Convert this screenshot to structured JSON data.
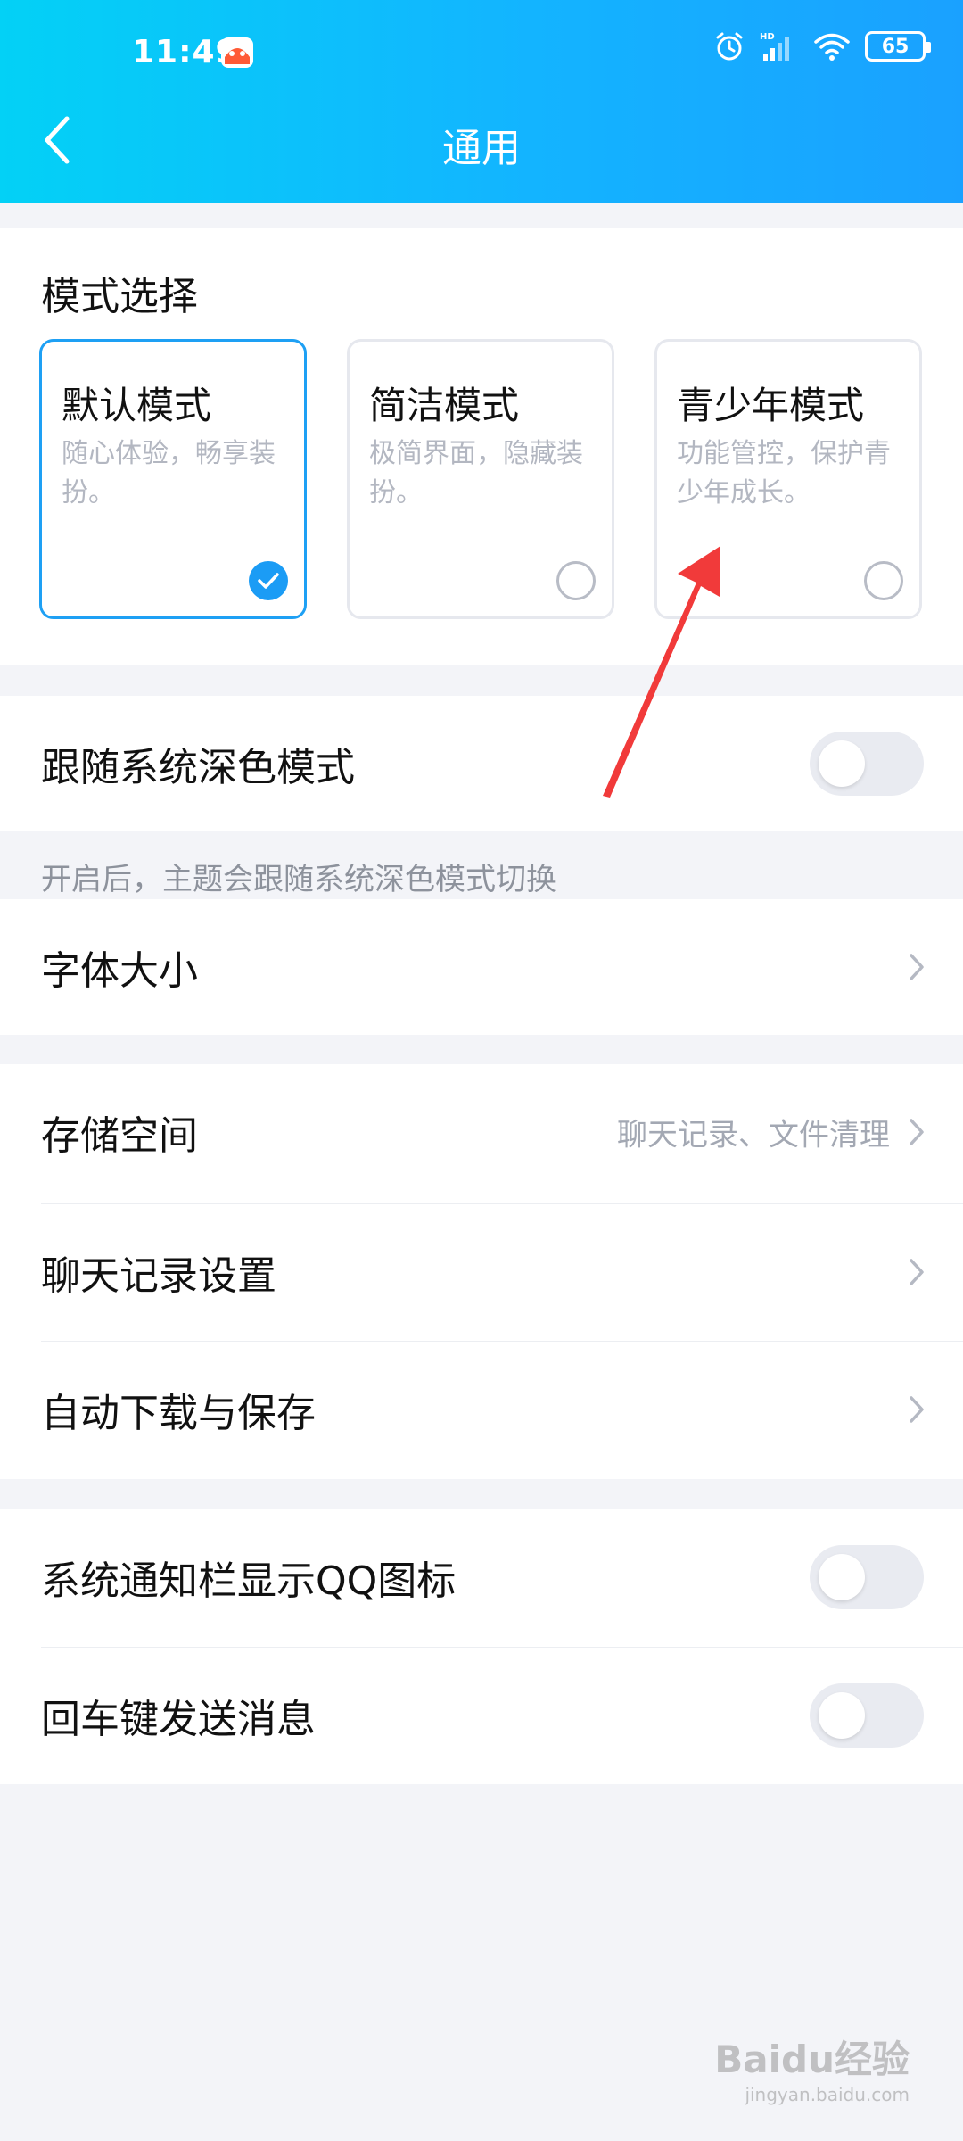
{
  "status_bar": {
    "time": "11:49",
    "battery": "65",
    "network_badge": "HD"
  },
  "header": {
    "title": "通用"
  },
  "mode_section": {
    "title": "模式选择",
    "cards": [
      {
        "title": "默认模式",
        "desc": "随心体验，畅享装扮。",
        "selected": true
      },
      {
        "title": "简洁模式",
        "desc": "极简界面，隐藏装扮。",
        "selected": false
      },
      {
        "title": "青少年模式",
        "desc": "功能管控，保护青少年成长。",
        "selected": false
      }
    ]
  },
  "dark_mode": {
    "label": "跟随系统深色模式",
    "enabled": false,
    "hint": "开启后，主题会跟随系统深色模式切换"
  },
  "font_size": {
    "label": "字体大小"
  },
  "storage_group": {
    "storage": {
      "label": "存储空间",
      "value": "聊天记录、文件清理"
    },
    "chat_history": {
      "label": "聊天记录设置"
    },
    "auto_download": {
      "label": "自动下载与保存"
    }
  },
  "toggles_group": {
    "notification_icon": {
      "label": "系统通知栏显示QQ图标",
      "enabled": false
    },
    "enter_to_send": {
      "label": "回车键发送消息",
      "enabled": false
    }
  },
  "watermark": {
    "logo": "Baidu经验",
    "url": "jingyan.baidu.com"
  },
  "colors": {
    "accent": "#1b9cf5",
    "header_start": "#03d1f6",
    "header_end": "#1aa1ff",
    "annotation": "#f13a3a"
  }
}
